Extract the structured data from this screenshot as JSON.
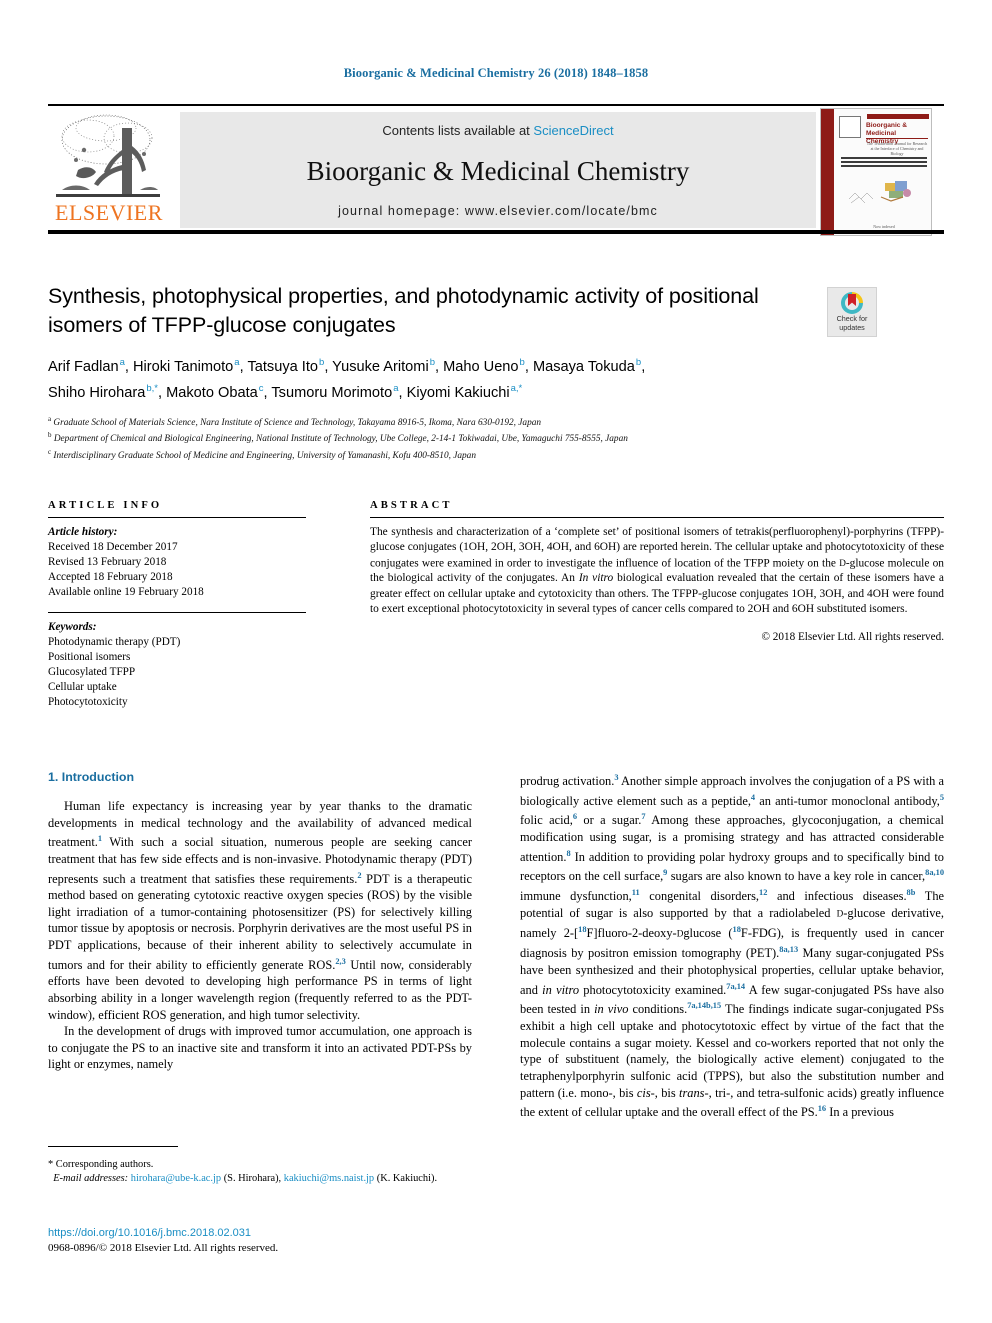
{
  "running_head": "Bioorganic & Medicinal Chemistry 26 (2018) 1848–1858",
  "masthead": {
    "contents_prefix": "Contents lists available at ",
    "sciencedirect": "ScienceDirect",
    "journal_title": "Bioorganic & Medicinal Chemistry",
    "homepage": "journal homepage: www.elsevier.com/locate/bmc",
    "publisher": "ELSEVIER",
    "cover": {
      "title": "Bioorganic & Medicinal Chemistry",
      "subtitle": "The Tetrahedron Journal for Research at the Interface of Chemistry and Biology",
      "footer": "Now indexed"
    }
  },
  "crossmark": {
    "line1": "Check for",
    "line2": "updates"
  },
  "article": {
    "title": "Synthesis, photophysical properties, and photodynamic activity of positional isomers of TFPP-glucose conjugates",
    "authors_line1": "Arif Fadlan a, Hiroki Tanimoto a, Tatsuya Ito b, Yusuke Aritomi b, Maho Ueno b, Masaya Tokuda b,",
    "authors_line2": "Shiho Hirohara b,*, Makoto Obata c, Tsumoru Morimoto a, Kiyomi Kakiuchi a,*",
    "affiliations": [
      "a Graduate School of Materials Science, Nara Institute of Science and Technology, Takayama 8916-5, Ikoma, Nara 630-0192, Japan",
      "b Department of Chemical and Biological Engineering, National Institute of Technology, Ube College, 2-14-1 Tokiwadai, Ube, Yamaguchi 755-8555, Japan",
      "c Interdisciplinary Graduate School of Medicine and Engineering, University of Yamanashi, Kofu 400-8510, Japan"
    ]
  },
  "article_info": {
    "heading": "ARTICLE INFO",
    "history_label": "Article history:",
    "history": [
      "Received 18 December 2017",
      "Revised 13 February 2018",
      "Accepted 18 February 2018",
      "Available online 19 February 2018"
    ],
    "keywords_label": "Keywords:",
    "keywords": [
      "Photodynamic therapy (PDT)",
      "Positional isomers",
      "Glucosylated TFPP",
      "Cellular uptake",
      "Photocytotoxicity"
    ]
  },
  "abstract": {
    "heading": "ABSTRACT",
    "text": "The synthesis and characterization of a ‘complete set’ of positional isomers of tetrakis(perfluorophenyl)-porphyrins (TFPP)-glucose conjugates (1OH, 2OH, 3OH, 4OH, and 6OH) are reported herein. The cellular uptake and photocytotoxicity of these conjugates were examined in order to investigate the influence of location of the TFPP moiety on the D-glucose molecule on the biological activity of the conjugates. An In vitro biological evaluation revealed that the certain of these isomers have a greater effect on cellular uptake and cytotoxicity than others. The TFPP-glucose conjugates 1OH, 3OH, and 4OH were found to exert exceptional photocytotoxicity in several types of cancer cells compared to 2OH and 6OH substituted isomers.",
    "copyright": "© 2018 Elsevier Ltd. All rights reserved."
  },
  "body": {
    "section_heading": "1. Introduction",
    "left_paragraph_1": "Human life expectancy is increasing year by year thanks to the dramatic developments in medical technology and the availability of advanced medical treatment.1 With such a social situation, numerous people are seeking cancer treatment that has few side effects and is non-invasive. Photodynamic therapy (PDT) represents such a treatment that satisfies these requirements.2 PDT is a therapeutic method based on generating cytotoxic reactive oxygen species (ROS) by the visible light irradiation of a tumor-containing photosensitizer (PS) for selectively killing tumor tissue by apoptosis or necrosis. Porphyrin derivatives are the most useful PS in PDT applications, because of their inherent ability to selectively accumulate in tumors and for their ability to efficiently generate ROS.2,3 Until now, considerably efforts have been devoted to developing high performance PS in terms of light absorbing ability in a longer wavelength region (frequently referred to as the PDT-window), efficient ROS generation, and high tumor selectivity.",
    "left_paragraph_2": "In the development of drugs with improved tumor accumulation, one approach is to conjugate the PS to an inactive site and transform it into an activated PDT-PSs by light or enzymes, namely",
    "right_paragraph_1": "prodrug activation.3 Another simple approach involves the conjugation of a PS with a biologically active element such as a peptide,4 an anti-tumor monoclonal antibody,5 folic acid,6 or a sugar.7 Among these approaches, glycoconjugation, a chemical modification using sugar, is a promising strategy and has attracted considerable attention.8 In addition to providing polar hydroxy groups and to specifically bind to receptors on the cell surface,9 sugars are also known to have a key role in cancer,8a,10 immune dysfunction,11 congenital disorders,12 and infectious diseases.8b The potential of sugar is also supported by that a radiolabeled D-glucose derivative, namely 2-[18F]fluoro-2-deoxy-D-glucose (18F-FDG), is frequently used in cancer diagnosis by positron emission tomography (PET).8a,13 Many sugar-conjugated PSs have been synthesized and their photophysical properties, cellular uptake behavior, and in vitro photocytotoxicity examined.7a,14 A few sugar-conjugated PSs have also been tested in in vivo conditions.7a,14b,15 The findings indicate sugar-conjugated PSs exhibit a high cell uptake and photocytotoxic effect by virtue of the fact that the molecule contains a sugar moiety. Kessel and co-workers reported that not only the type of substituent (namely, the biologically active element) conjugated to the tetraphenylporphyrin sulfonic acid (TPPS), but also the substitution number and pattern (i.e. mono-, bis cis-, bis trans-, tri-, and tetra-sulfonic acids) greatly influence the extent of cellular uptake and the overall effect of the PS.16 In a previous"
  },
  "footnotes": {
    "corresponding": "* Corresponding authors.",
    "email_label": "E-mail addresses:",
    "email_1": "hirohara@ube-k.ac.jp",
    "email_1_name": "(S. Hirohara),",
    "email_2": "kakiuchi@ms.naist.jp",
    "email_2_name": "(K. Kakiuchi).",
    "doi": "https://doi.org/10.1016/j.bmc.2018.02.031",
    "issn": "0968-0896/© 2018 Elsevier Ltd. All rights reserved."
  },
  "colors": {
    "link_blue": "#1a8ec4",
    "heading_blue": "#1a6ea0",
    "elsevier_orange": "#ee7421",
    "cover_red": "#8e1b17"
  }
}
